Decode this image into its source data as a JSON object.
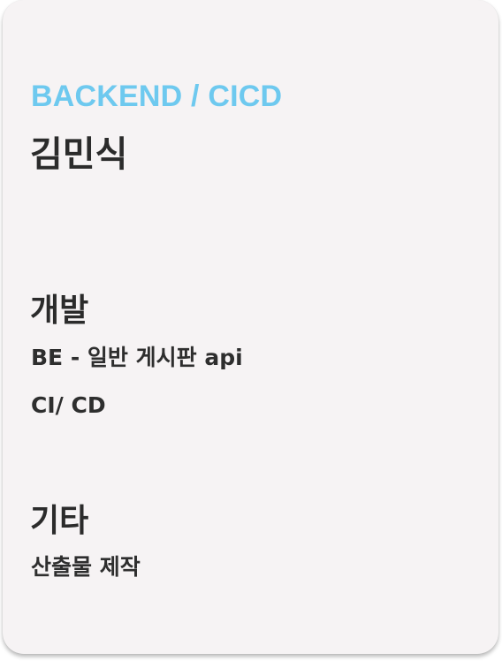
{
  "card": {
    "role": "BACKEND / CICD",
    "name": "김민식",
    "sections": [
      {
        "title": "개발",
        "items": [
          "BE - 일반 게시판 api",
          "CI/ CD"
        ]
      },
      {
        "title": "기타",
        "items": [
          "산출물 제작"
        ]
      }
    ]
  },
  "colors": {
    "accent": "#6ec9ef",
    "text": "#2b2b2b",
    "card_background": "#f6f3f4"
  }
}
